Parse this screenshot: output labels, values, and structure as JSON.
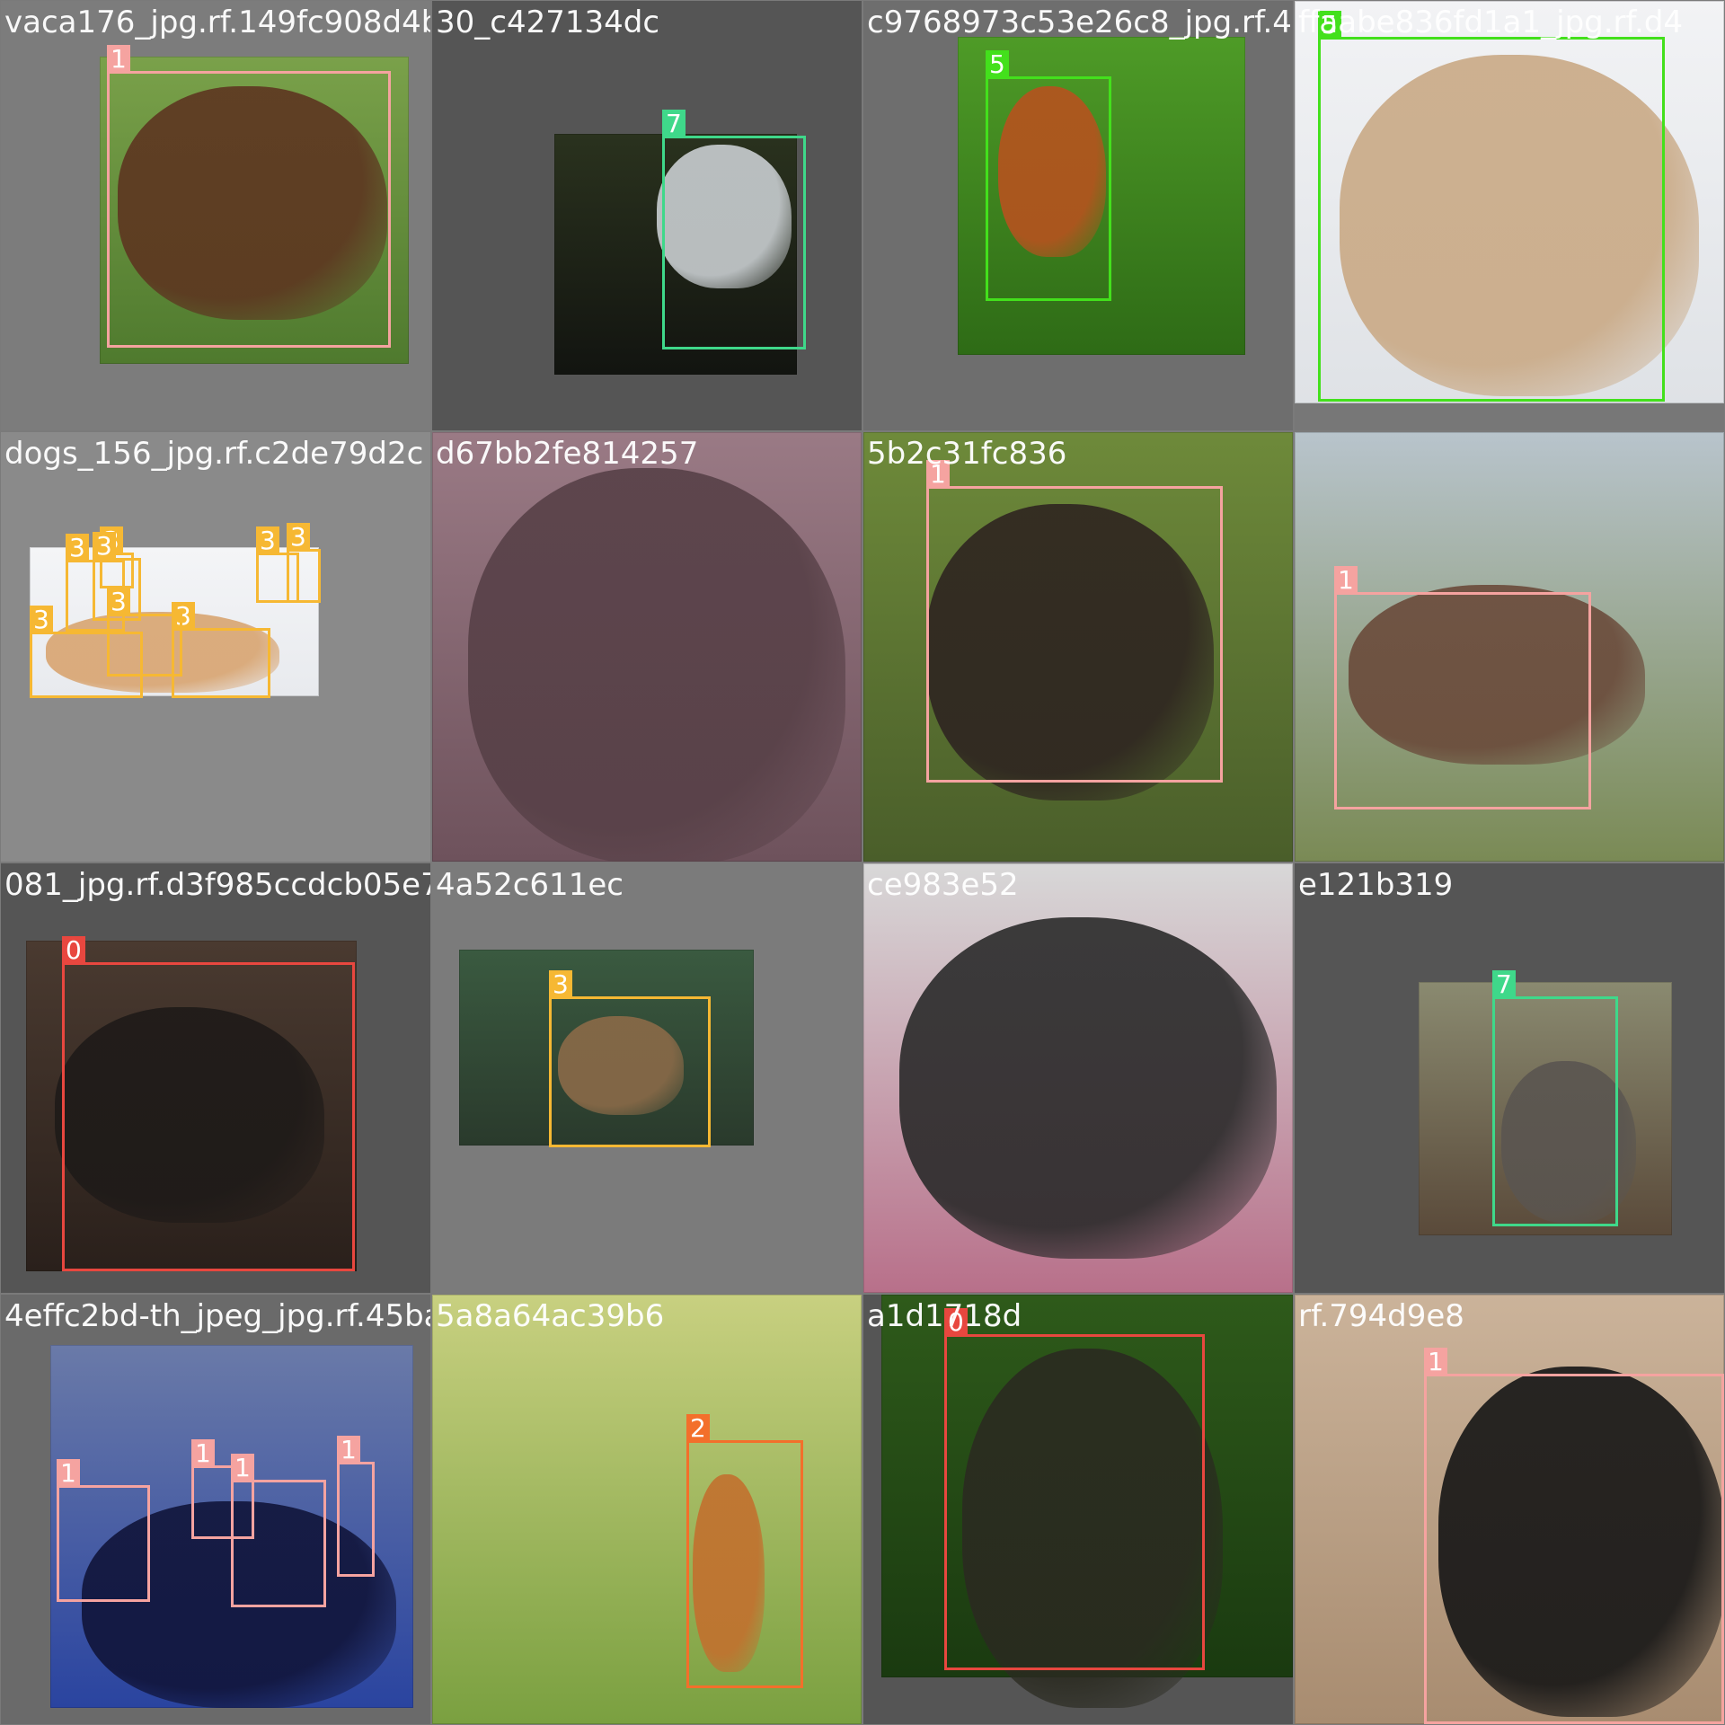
{
  "class_colors": {
    "0": "#e8473f",
    "1": "#f5a3a0",
    "2": "#f36f2b",
    "3": "#f6b833",
    "5": "#43e01c",
    "7": "#3fd88a"
  },
  "tiles": [
    {
      "caption": "vaca176_jpg.rf.149fc908d4b",
      "background": "#7c7c7c",
      "photo_colors": [
        "#7aa14a",
        "#4f7a2e"
      ],
      "animal_color": "#5d3520",
      "boxes": [
        {
          "label": "1"
        }
      ]
    },
    {
      "caption": "30_c427134dc",
      "background": "#555555",
      "photo_colors": [
        "#2a321e",
        "#121410"
      ],
      "animal_color": "#c9ced1",
      "boxes": [
        {
          "label": "7"
        }
      ]
    },
    {
      "caption": "c9768973c53e26c8_jpg.rf.4",
      "background": "#6e6e6e",
      "photo_colors": [
        "#4e9b27",
        "#2e6b16"
      ],
      "animal_color": "#b6521e",
      "boxes": [
        {
          "label": "5"
        }
      ]
    },
    {
      "caption": "ffaabe836fd1a1_jpg.rf.d4",
      "background": "#777777",
      "photo_colors": [
        "#f2f3f5",
        "#dfe2e6"
      ],
      "animal_color": "#c9a985",
      "boxes": [
        {
          "label": "5"
        }
      ]
    },
    {
      "caption": "dogs_156_jpg.rf.c2de79d2c",
      "background": "#8a8a8a",
      "photo_colors": [
        "#f4f5f7",
        "#e8eaee"
      ],
      "animal_color": "#d8a470",
      "boxes": [
        {
          "label": "3"
        },
        {
          "label": "3"
        },
        {
          "label": "3"
        },
        {
          "label": "3"
        },
        {
          "label": "3"
        },
        {
          "label": "3"
        },
        {
          "label": "3"
        },
        {
          "label": "3"
        }
      ]
    },
    {
      "caption": "d67bb2fe814257",
      "background": "#8f6f78",
      "photo_colors": [
        "#9a7a85",
        "#6e525c"
      ],
      "animal_color": "#574047",
      "boxes": []
    },
    {
      "caption": "5b2c31fc836",
      "background": "#6f6f6f",
      "photo_colors": [
        "#6e8a3a",
        "#4a5e2a"
      ],
      "animal_color": "#2e2420",
      "boxes": [
        {
          "label": "1"
        }
      ]
    },
    {
      "caption": "",
      "background": "#8a9095",
      "photo_colors": [
        "#b8c4cc",
        "#7a8a55"
      ],
      "animal_color": "#6a4a3a",
      "boxes": [
        {
          "label": "1"
        }
      ]
    },
    {
      "caption": "081_jpg.rf.d3f985ccdcb05e7",
      "background": "#555555",
      "photo_colors": [
        "#4a3a30",
        "#2a201b"
      ],
      "animal_color": "#1e1a18",
      "boxes": [
        {
          "label": "0"
        }
      ]
    },
    {
      "caption": "4a52c611ec",
      "background": "#7b7b7b",
      "photo_colors": [
        "#3a5a40",
        "#2a3a2c"
      ],
      "animal_color": "#8a6a48",
      "boxes": [
        {
          "label": "3"
        }
      ]
    },
    {
      "caption": "ce983e52",
      "background": "#6a6a6a",
      "photo_colors": [
        "#d8d8d8",
        "#b8708a"
      ],
      "animal_color": "#2a2a2a",
      "boxes": []
    },
    {
      "caption": "e121b319",
      "background": "#555555",
      "photo_colors": [
        "#8a8a70",
        "#5a4a3a"
      ],
      "animal_color": "#5a5550",
      "boxes": [
        {
          "label": "7"
        }
      ]
    },
    {
      "caption": "4effc2bd-th_jpeg_jpg.rf.45ba",
      "background": "#6a6a6a",
      "photo_colors": [
        "#6a7aa8",
        "#2a44a0"
      ],
      "animal_color": "#10143a",
      "boxes": [
        {
          "label": "1"
        },
        {
          "label": "1"
        },
        {
          "label": "1"
        },
        {
          "label": "1"
        }
      ]
    },
    {
      "caption": "5a8a64ac39b6",
      "background": "#5e6a3a",
      "photo_colors": [
        "#c8d080",
        "#7aa040"
      ],
      "animal_color": "#c2702e",
      "boxes": [
        {
          "label": "2"
        }
      ]
    },
    {
      "caption": "a1d1718d",
      "background": "#555555",
      "photo_colors": [
        "#2e5a1a",
        "#1a3a10"
      ],
      "animal_color": "#2a2a20",
      "boxes": [
        {
          "label": "0"
        }
      ]
    },
    {
      "caption": "rf.794d9e8",
      "background": "#bba590",
      "photo_colors": [
        "#cbb39a",
        "#a88c70"
      ],
      "animal_color": "#151515",
      "boxes": [
        {
          "label": "1"
        }
      ]
    }
  ]
}
